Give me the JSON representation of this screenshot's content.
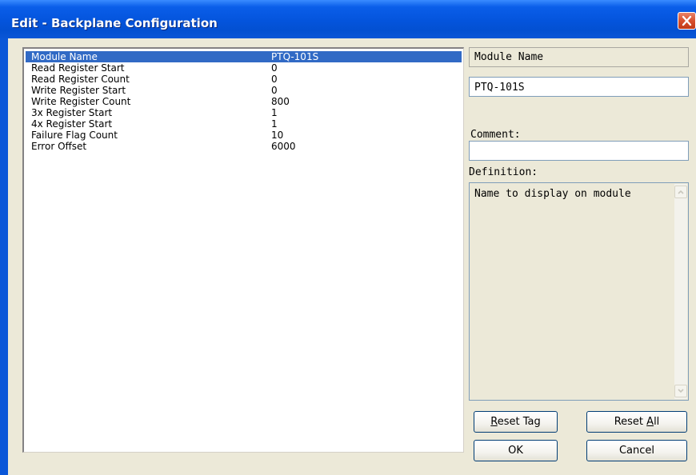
{
  "window": {
    "title": "Edit - Backplane Configuration"
  },
  "list": {
    "rows": [
      {
        "name": "Module Name",
        "value": "PTQ-101S"
      },
      {
        "name": "Read Register Start",
        "value": "0"
      },
      {
        "name": "Read Register Count",
        "value": "0"
      },
      {
        "name": "Write Register Start",
        "value": "0"
      },
      {
        "name": "Write Register Count",
        "value": "800"
      },
      {
        "name": "3x Register Start",
        "value": "1"
      },
      {
        "name": "4x Register Start",
        "value": "1"
      },
      {
        "name": "Failure Flag Count",
        "value": "10"
      },
      {
        "name": "Error Offset",
        "value": "6000"
      }
    ],
    "selected_index": 0
  },
  "detail": {
    "param_name": "Module Name",
    "value": "PTQ-101S",
    "comment_label": "Comment:",
    "comment_value": "",
    "definition_label": "Definition:",
    "definition_text": "Name to display on module"
  },
  "buttons": {
    "reset_tag": {
      "pre": "",
      "hot": "R",
      "post": "eset Tag"
    },
    "reset_all": {
      "pre": "Reset ",
      "hot": "A",
      "post": "ll"
    },
    "ok": "OK",
    "cancel": "Cancel"
  },
  "colors": {
    "titlebar": "#0454dc",
    "selection": "#316ac5",
    "dialog_bg": "#ece9d8",
    "close_button": "#d7502d"
  },
  "icons": {
    "close": "close-icon",
    "scroll_up": "chevron-up-icon",
    "scroll_down": "chevron-down-icon"
  }
}
